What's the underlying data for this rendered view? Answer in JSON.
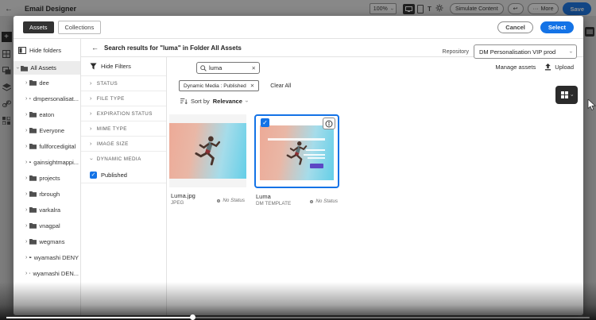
{
  "app": {
    "title": "Email Designer",
    "toolbar": {
      "zoom": "100%",
      "device_text": "T",
      "simulate": "Simulate Content",
      "more": "More",
      "save": "Save"
    }
  },
  "dialog": {
    "tabs": [
      {
        "label": "Assets",
        "active": true
      },
      {
        "label": "Collections",
        "active": false
      }
    ],
    "actions": {
      "cancel": "Cancel",
      "select": "Select"
    },
    "folders": {
      "hide_label": "Hide folders",
      "root": "All Assets",
      "items": [
        "dee",
        "dmpersonalisat...",
        "eaton",
        "Everyone",
        "fullforcedigital",
        "gainsightmappi...",
        "projects",
        "rbrough",
        "varkalra",
        "vnagpal",
        "wegmans",
        "wyamashi DENY",
        "wyamashi DEN..."
      ]
    },
    "results_header": "Search results for \"luma\" in Folder All Assets",
    "repository": {
      "label": "Repository",
      "value": "DM Personalisation VIP prod"
    },
    "manage_assets": "Manage assets",
    "upload": "Upload",
    "filters": {
      "hide_label": "Hide Filters",
      "sections": [
        "STATUS",
        "FILE TYPE",
        "EXPIRATION STATUS",
        "MIME TYPE",
        "IMAGE SIZE",
        "DYNAMIC MEDIA"
      ],
      "published": "Published",
      "published_checked": true
    },
    "search": {
      "value": "luma"
    },
    "chips": [
      {
        "label": "Dynamic Media : Published"
      }
    ],
    "clear_all": "Clear All",
    "sort": {
      "label": "Sort by",
      "value": "Relevance"
    },
    "assets": [
      {
        "name": "Luma.jpg",
        "type": "JPEG",
        "status": "No Status",
        "selected": false
      },
      {
        "name": "Luma",
        "type": "DM TEMPLATE",
        "status": "No Status",
        "selected": true
      }
    ]
  },
  "colors": {
    "accent": "#1473e6",
    "tab_active": "#333333",
    "card_selected_border": "#1473e6"
  }
}
